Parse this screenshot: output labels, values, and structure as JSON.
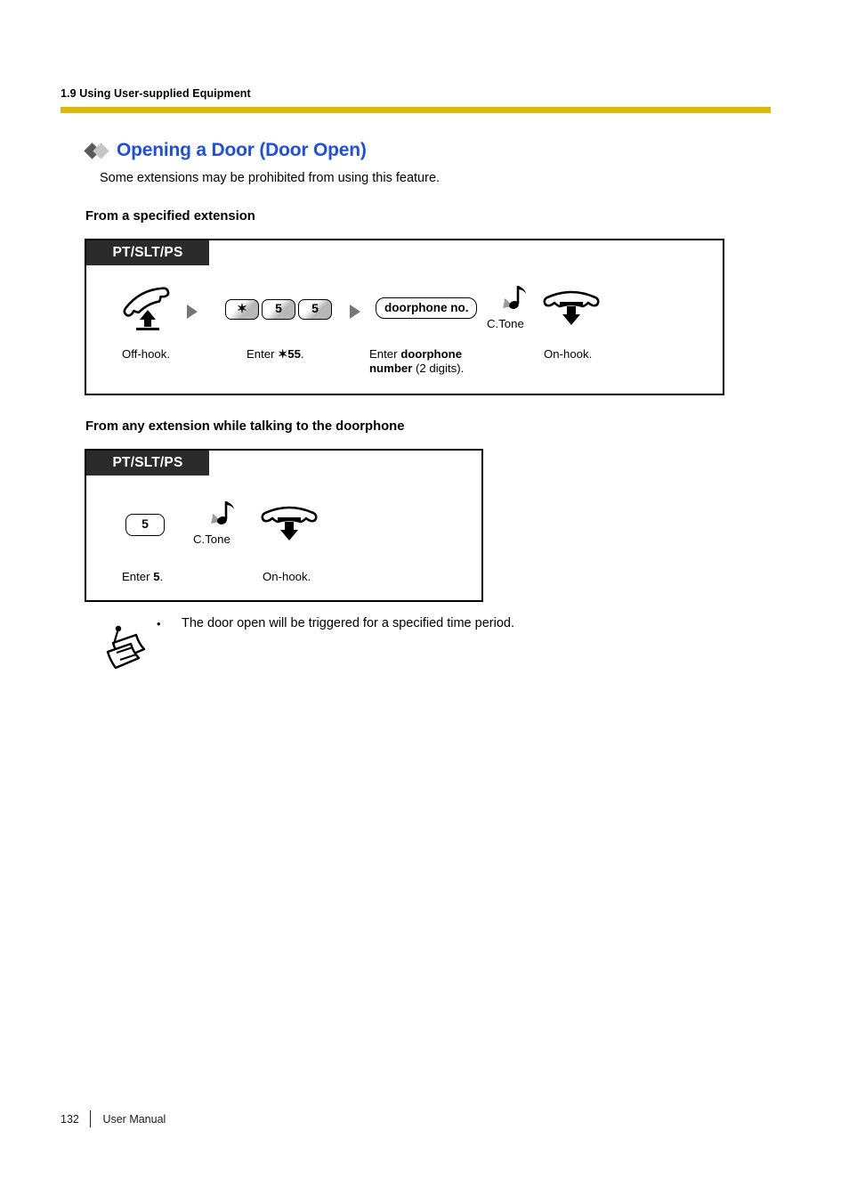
{
  "page": {
    "running_header": "1.9 Using User-supplied Equipment",
    "heading": "Opening a Door (Door Open)",
    "lead": "Some extensions may be prohibited from using this feature.",
    "rule_color": "#ddb80b",
    "heading_color": "#1f4fe0"
  },
  "sections": [
    {
      "title": "From a specified extension",
      "device_tag": "PT/SLT/PS",
      "steps": [
        {
          "icon": "handset-offhook-icon",
          "caption": "Off-hook."
        },
        {
          "keys": [
            "✶",
            "5",
            "5"
          ],
          "caption_prefix": "Enter ",
          "caption_bold": "✶55",
          "caption_suffix": "."
        },
        {
          "field_label": "doorphone no.",
          "caption_prefix": "Enter ",
          "caption_bold": "doorphone number",
          "caption_suffix": " (2 digits)."
        },
        {
          "icon": "confirmation-tone-icon",
          "label": "C.Tone"
        },
        {
          "icon": "handset-onhook-icon",
          "caption": "On-hook."
        }
      ]
    },
    {
      "title": "From any extension while talking to the doorphone",
      "device_tag": "PT/SLT/PS",
      "steps": [
        {
          "keys": [
            "5"
          ],
          "caption_prefix": "Enter ",
          "caption_bold": "5",
          "caption_suffix": "."
        },
        {
          "icon": "confirmation-tone-icon",
          "label": "C.Tone"
        },
        {
          "icon": "handset-onhook-icon",
          "caption": "On-hook."
        }
      ]
    }
  ],
  "note": {
    "bullet": "•",
    "text": "The door open will be triggered for a specified time period."
  },
  "footer": {
    "page_number": "132",
    "document_title": "User Manual"
  }
}
